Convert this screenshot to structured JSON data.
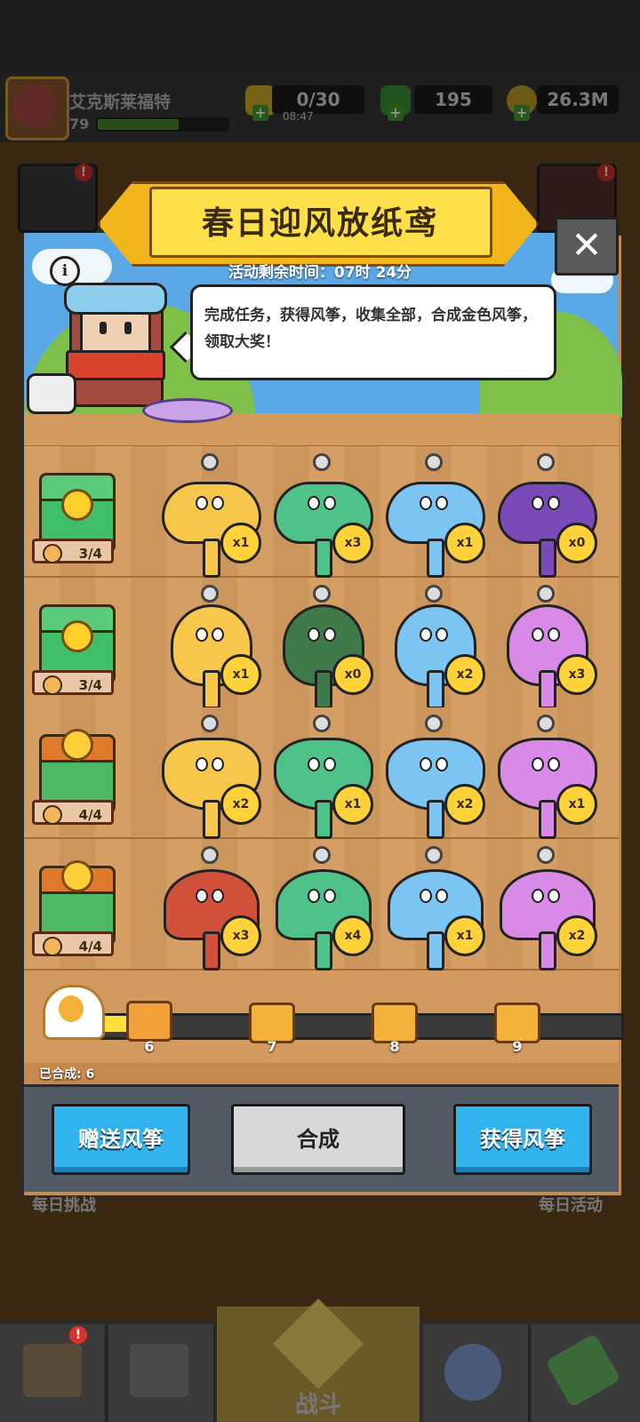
{
  "player": {
    "name": "艾克斯莱福特",
    "level": "79",
    "xp_fraction": 0.62
  },
  "resources": {
    "energy": {
      "value": "0/30",
      "timer": "08:47",
      "icon": "lightning-icon"
    },
    "gems": {
      "value": "195",
      "icon": "gem-icon"
    },
    "gold": {
      "value": "26.3M",
      "icon": "coin-icon"
    }
  },
  "modal": {
    "title": "春日迎风放纸鸢",
    "timer": "活动剩余时间：07时 24分",
    "description": "完成任务，获得风筝，收集全部，合成金色风筝，领取大奖！",
    "close_icon": "✕",
    "info_icon": "i"
  },
  "rows": [
    {
      "reward": "3/4",
      "kites": [
        "x1",
        "x3",
        "x1",
        "x0"
      ],
      "kind": "cat"
    },
    {
      "reward": "3/4",
      "kites": [
        "x1",
        "x0",
        "x2",
        "x3"
      ],
      "kind": "beetle"
    },
    {
      "reward": "4/4",
      "kites": [
        "x2",
        "x1",
        "x2",
        "x1"
      ],
      "kind": "butterfly"
    },
    {
      "reward": "4/4",
      "kites": [
        "x3",
        "x4",
        "x1",
        "x2"
      ],
      "kind": "bird"
    }
  ],
  "colors": {
    "yellow": "#f7c64a",
    "green": "#4fc28a",
    "blue": "#7cc4f2",
    "purple": "#7a4ab8",
    "pink": "#d88ae6",
    "red": "#d0503a",
    "darkgreen": "#3f7a4a"
  },
  "progress": {
    "merged_label": "已合成: 6",
    "milestones": [
      "6",
      "7",
      "8",
      "9"
    ],
    "current": 6
  },
  "buttons": {
    "gift": "赠送风筝",
    "merge": "合成",
    "obtain": "获得风筝"
  },
  "nav": {
    "battle": "战斗",
    "daily_challenge": "每日挑战",
    "daily_event": "每日活动"
  }
}
